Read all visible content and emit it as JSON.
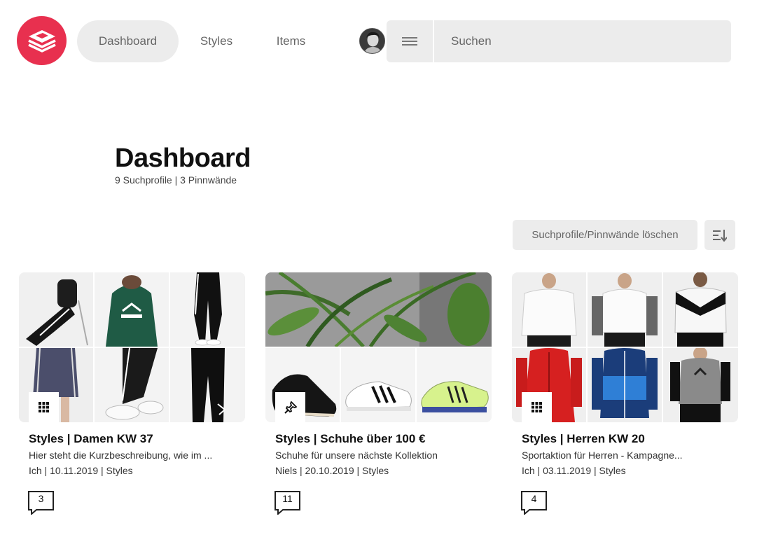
{
  "colors": {
    "brand": "#e8304f",
    "chip": "#ececec"
  },
  "header": {
    "logo_icon": "stacked-cards-logo",
    "nav": [
      {
        "label": "Dashboard",
        "active": true
      },
      {
        "label": "Styles",
        "active": false
      },
      {
        "label": "Items",
        "active": false
      }
    ],
    "menu_icon": "hamburger-icon",
    "search_placeholder": "Suchen"
  },
  "page": {
    "title": "Dashboard",
    "subtitle": "9 Suchprofile | 3 Pinnwände"
  },
  "actions": {
    "delete_label": "Suchprofile/Pinnwände löschen",
    "sort_icon": "sort-icon"
  },
  "cards": [
    {
      "type_icon": "grid-icon",
      "title": "Styles | Damen KW 37",
      "description": "Hier steht die Kurzbeschreibung, wie im ...",
      "meta": "Ich | 10.11.2019 | Styles",
      "comments": "3"
    },
    {
      "type_icon": "pin-icon",
      "title": "Styles | Schuhe über 100 €",
      "description": "Schuhe für unsere nächste Kollektion",
      "meta": "Niels | 20.10.2019 | Styles",
      "comments": "11"
    },
    {
      "type_icon": "grid-icon",
      "title": "Styles | Herren KW 20",
      "description": "Sportaktion für Herren - Kampagne...",
      "meta": "Ich | 03.11.2019 | Styles",
      "comments": "4"
    }
  ]
}
